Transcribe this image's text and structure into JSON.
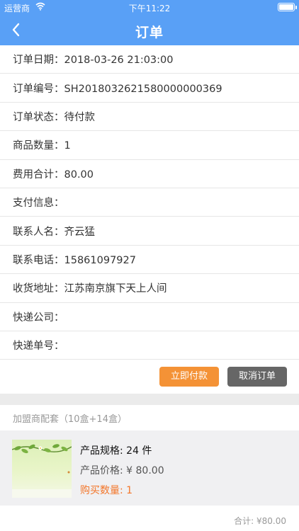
{
  "status_bar": {
    "carrier": "运营商",
    "time": "下午11:22"
  },
  "nav": {
    "title": "订单",
    "back_icon": "chevron-left-icon"
  },
  "order_info": [
    {
      "text": "订单日期：2018-03-26 21:03:00"
    },
    {
      "text": "订单编号：SH2018032621580000000369"
    },
    {
      "text": "订单状态：待付款"
    },
    {
      "text": "商品数量：1"
    },
    {
      "text": "费用合计：80.00"
    },
    {
      "text": "支付信息："
    },
    {
      "text": "联系人名：齐云猛"
    },
    {
      "text": "联系电话：15861097927"
    },
    {
      "text": "收货地址：江苏南京旗下天上人间"
    },
    {
      "text": "快递公司："
    },
    {
      "text": "快递单号："
    }
  ],
  "actions": {
    "pay_label": "立即付款",
    "cancel_label": "取消订单"
  },
  "kit": {
    "title": "加盟商配套（10盒+14盒）"
  },
  "product": {
    "spec": "产品规格: 24 件",
    "price": "产品价格: ¥ 80.00",
    "quantity": "购买数量: 1"
  },
  "total": {
    "text": "合计: ¥80.00"
  },
  "colors": {
    "nav_blue": "#59a0f6",
    "pay_orange": "#f49236",
    "cancel_gray": "#666666",
    "quantity_orange": "#f3762a"
  }
}
